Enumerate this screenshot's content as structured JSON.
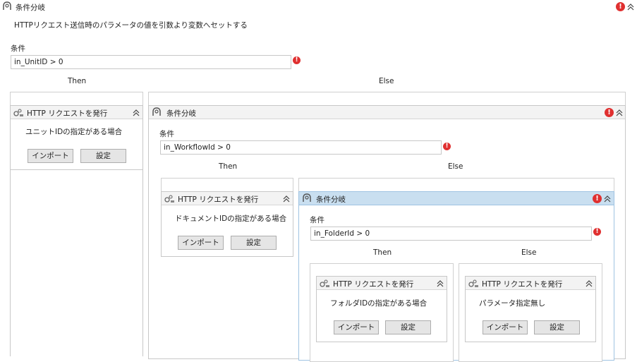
{
  "root": {
    "title": "条件分岐",
    "description": "HTTPリクエスト送信時のパラメータの値を引数より変数へセットする",
    "condition_label": "条件",
    "condition_value": "in_UnitID > 0",
    "then_label": "Then",
    "else_label": "Else"
  },
  "then_activity": {
    "title": "HTTP リクエストを発行",
    "note": "ユニットIDの指定がある場合",
    "import_label": "インポート",
    "settings_label": "設定"
  },
  "else_if": {
    "title": "条件分岐",
    "condition_label": "条件",
    "condition_value": "in_WorkflowId > 0",
    "then_label": "Then",
    "else_label": "Else"
  },
  "else_then_activity": {
    "title": "HTTP リクエストを発行",
    "note": "ドキュメントIDの指定がある場合",
    "import_label": "インポート",
    "settings_label": "設定"
  },
  "inner_if": {
    "title": "条件分岐",
    "condition_label": "条件",
    "condition_value": "in_FolderId > 0",
    "then_label": "Then",
    "else_label": "Else"
  },
  "inner_then_activity": {
    "title": "HTTP リクエストを発行",
    "note": "フォルダIDの指定がある場合",
    "import_label": "インポート",
    "settings_label": "設定"
  },
  "inner_else_activity": {
    "title": "HTTP リクエストを発行",
    "note": "パラメータ指定無し",
    "import_label": "インポート",
    "settings_label": "設定"
  },
  "icons": {
    "if": "if-branch-icon",
    "http": "http-request-icon",
    "error": "error-icon",
    "collapse": "chevron-double-up-icon"
  },
  "colors": {
    "error": "#e03030",
    "selected_header": "#c9dff0",
    "button_bg": "#e5e5e5"
  }
}
